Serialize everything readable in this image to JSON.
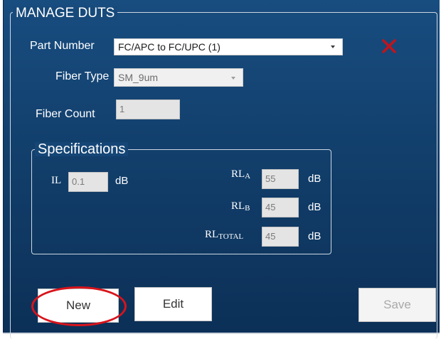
{
  "manage_duts": {
    "title": "MANAGE DUTS",
    "part_number": {
      "label": "Part Number",
      "value": "FC/APC to FC/UPC (1)"
    },
    "fiber_type": {
      "label": "Fiber Type",
      "value": "SM_9um"
    },
    "fiber_count": {
      "label": "Fiber Count",
      "value": "1"
    },
    "delete_icon": "close-x-icon",
    "delete_icon_color": "#c0141c"
  },
  "specifications": {
    "title": "Specifications",
    "il": {
      "label": "IL",
      "value": "0.1",
      "unit": "dB"
    },
    "rl_a": {
      "label": "RL",
      "sub": "A",
      "value": "55",
      "unit": "dB"
    },
    "rl_b": {
      "label": "RL",
      "sub": "B",
      "value": "45",
      "unit": "dB"
    },
    "rl_total": {
      "label": "RL",
      "sub": "TOTAL",
      "value": "45",
      "unit": "dB"
    }
  },
  "actions": {
    "new_label": "New",
    "edit_label": "Edit",
    "save_label": "Save"
  },
  "annotation": {
    "highlight_color": "#d9131b",
    "highlight_target": "New"
  }
}
